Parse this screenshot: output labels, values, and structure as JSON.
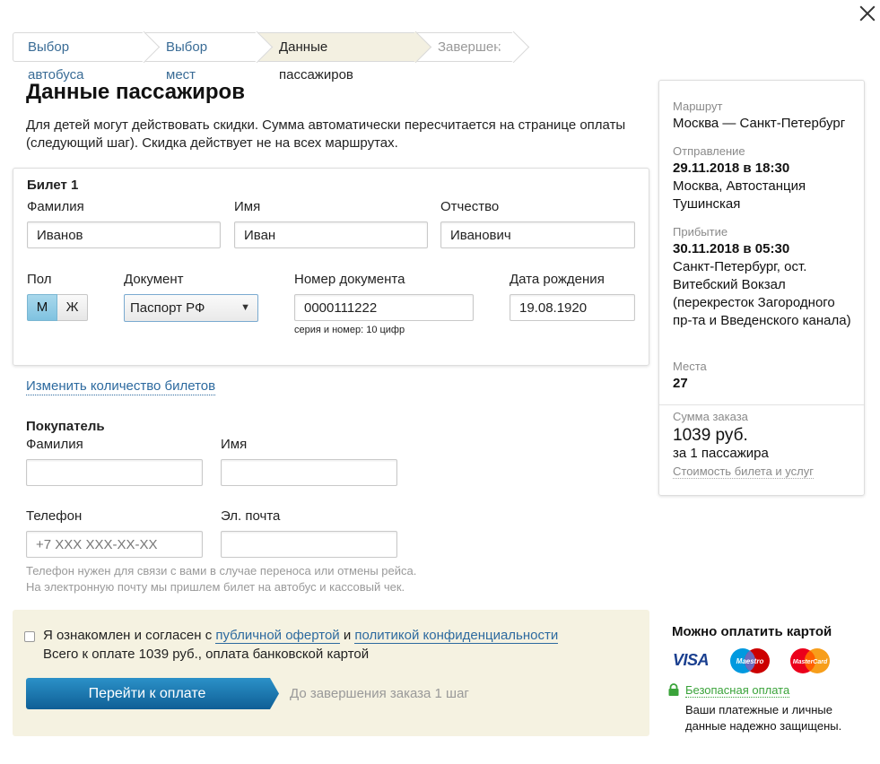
{
  "steps": [
    "Выбор автобуса",
    "Выбор мест",
    "Данные пассажиров",
    "Завершение"
  ],
  "page_title": "Данные пассажиров",
  "intro": "Для детей могут действовать скидки. Сумма автоматически пересчитается на странице оплаты (следующий шаг). Скидка действует не на всех маршрутах.",
  "ticket": {
    "title": "Билет 1",
    "surname_label": "Фамилия",
    "surname_value": "Иванов",
    "name_label": "Имя",
    "name_value": "Иван",
    "patronymic_label": "Отчество",
    "patronymic_value": "Иванович",
    "gender_label": "Пол",
    "gender_m": "М",
    "gender_f": "Ж",
    "document_label": "Документ",
    "document_value": "Паспорт РФ",
    "doc_number_label": "Номер документа",
    "doc_number_value": "0000111222",
    "doc_number_hint": "серия и номер: 10 цифр",
    "birth_label": "Дата рождения",
    "birth_value": "19.08.1920"
  },
  "change_tickets_link": "Изменить количество билетов",
  "buyer": {
    "title": "Покупатель",
    "surname_label": "Фамилия",
    "name_label": "Имя",
    "phone_label": "Телефон",
    "phone_placeholder": "+7 XXX XXX-XX-XX",
    "email_label": "Эл. почта",
    "note_line1": "Телефон нужен для связи с вами в случае переноса или отмены рейса.",
    "note_line2": "На электронную почту мы пришлем билет на автобус и кассовый чек."
  },
  "confirm": {
    "agree_prefix": "Я ознакомлен и согласен с",
    "offer_link": "публичной офертой",
    "and_text": "и",
    "privacy_link": "политикой конфиденциальности",
    "total_text": "Всего к оплате 1039 руб., оплата банковской картой",
    "pay_button": "Перейти к оплате",
    "steps_left": "До завершения заказа 1 шаг"
  },
  "sidebar": {
    "route_label": "Маршрут",
    "route_value": "Москва — Санкт-Петербург",
    "departure_label": "Отправление",
    "departure_datetime": "29.11.2018 в 18:30",
    "departure_place": "Москва, Автостанция Тушинская",
    "arrival_label": "Прибытие",
    "arrival_datetime": "30.11.2018 в 05:30",
    "arrival_place": "Санкт-Петербург, ост. Витебский Вокзал (перекресток Загородного пр-та и Введенского канала)",
    "seats_label": "Места",
    "seats_value": "27",
    "sum_label": "Сумма заказа",
    "sum_value": "1039 руб.",
    "sum_for": "за 1 пассажира",
    "cost_link": "Стоимость билета и услуг"
  },
  "payment": {
    "title": "Можно оплатить картой",
    "visa_text": "VISA",
    "maestro_text": "Maestro",
    "mastercard_text": "MasterCard",
    "secure_link": "Безопасная оплата",
    "secure_note_line1": "Ваши платежные и личные",
    "secure_note_line2": "данные надежно защищены."
  },
  "icons": [
    "close-icon",
    "chevron-down-icon",
    "lock-icon"
  ],
  "colors": {
    "accent_blue": "#2d6a9f",
    "button_blue": "#1a78b4",
    "confirm_bg": "#f5f2e1",
    "secure_green": "#3aa33a"
  }
}
